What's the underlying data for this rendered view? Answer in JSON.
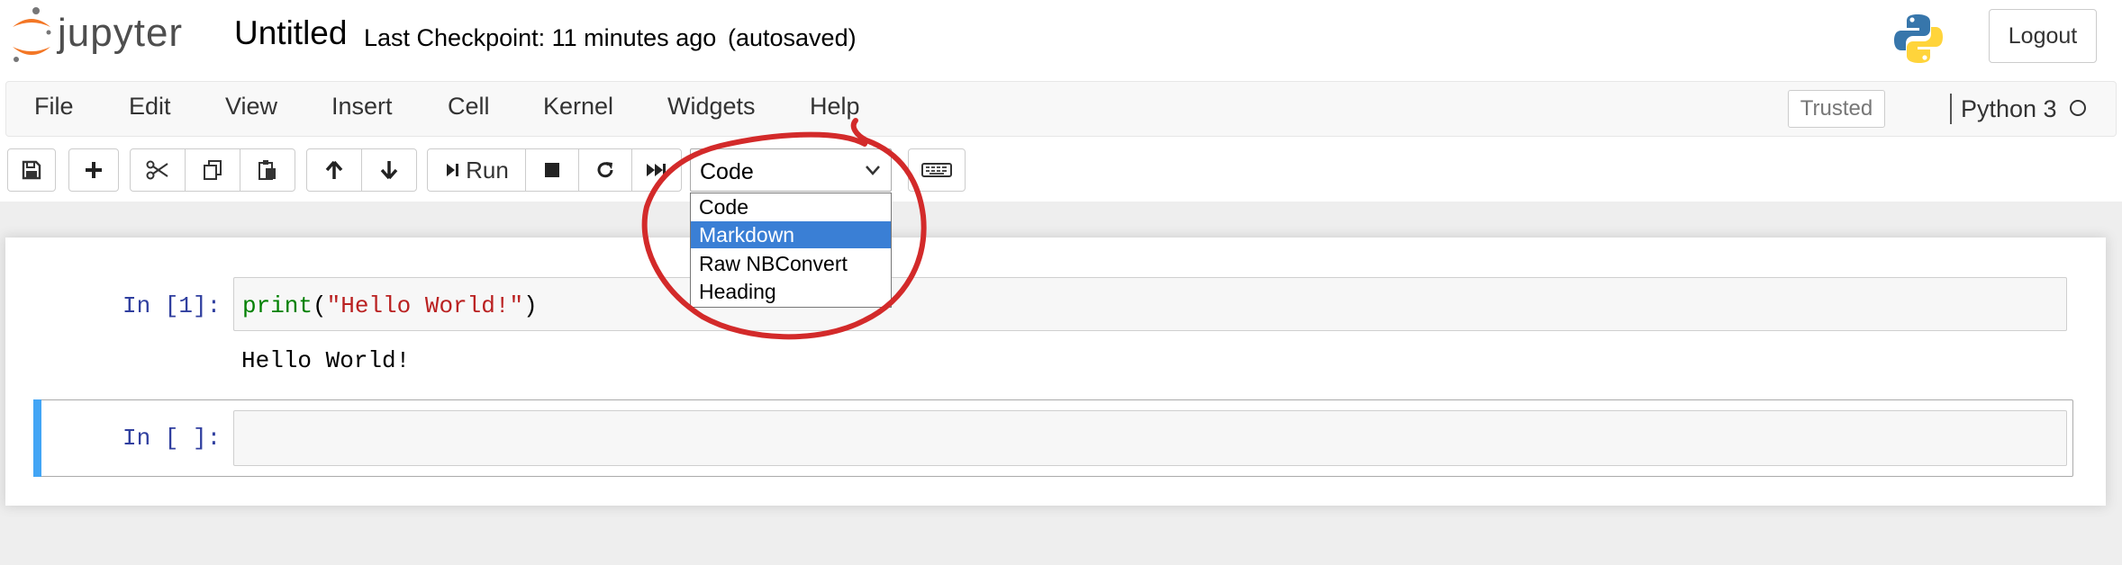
{
  "header": {
    "logo_text": "jupyter",
    "notebook_name": "Untitled",
    "checkpoint": "Last Checkpoint: 11 minutes ago",
    "autosave": "(autosaved)",
    "logout_label": "Logout"
  },
  "menubar": {
    "items": [
      "File",
      "Edit",
      "View",
      "Insert",
      "Cell",
      "Kernel",
      "Widgets",
      "Help"
    ],
    "trusted_label": "Trusted",
    "kernel_name": "Python 3"
  },
  "toolbar": {
    "run_label": "Run",
    "cell_type": {
      "selected": "Code",
      "options": [
        "Code",
        "Markdown",
        "Raw NBConvert",
        "Heading"
      ],
      "highlighted": "Markdown"
    }
  },
  "cells": [
    {
      "prompt": "In [1]:",
      "code_parts": [
        "print",
        "(",
        "\"Hello World!\"",
        ")"
      ],
      "output": "Hello World!"
    },
    {
      "prompt": "In [ ]:",
      "code": ""
    }
  ],
  "colors": {
    "prompt": "#303f9f",
    "selected_cell_bar": "#42a5f5",
    "option_highlight": "#3a7fd5",
    "annotation": "#d32a2a"
  }
}
